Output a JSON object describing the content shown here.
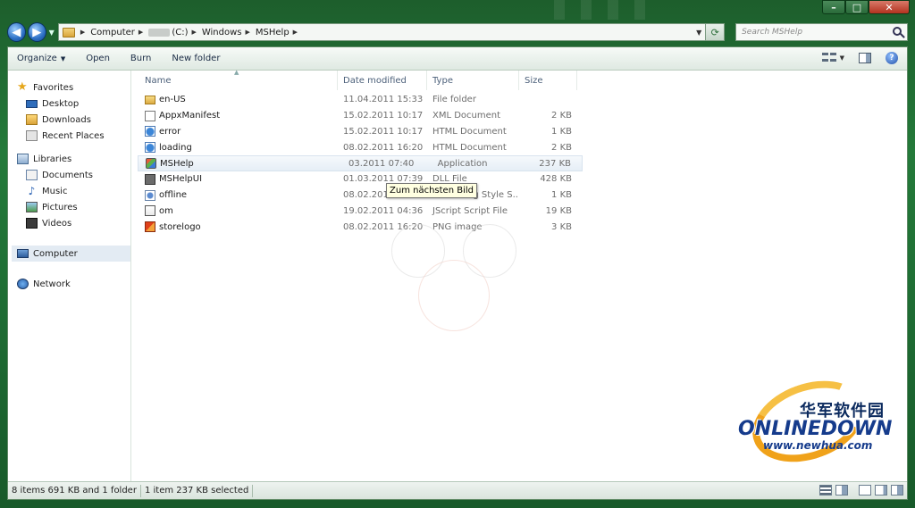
{
  "window": {
    "minimize": "–",
    "maximize": "□",
    "close": "✕"
  },
  "nav": {
    "back": "◀",
    "forward": "▶"
  },
  "address": {
    "crumbs": [
      "Computer",
      "(C:)",
      "Windows",
      "MSHelp"
    ]
  },
  "search": {
    "placeholder": "Search MSHelp"
  },
  "toolbar": {
    "organize": "Organize",
    "open": "Open",
    "burn": "Burn",
    "new_folder": "New folder"
  },
  "sidebar": {
    "favorites": "Favorites",
    "desktop": "Desktop",
    "downloads": "Downloads",
    "recent_places": "Recent Places",
    "libraries": "Libraries",
    "documents": "Documents",
    "music": "Music",
    "pictures": "Pictures",
    "videos": "Videos",
    "computer": "Computer",
    "network": "Network"
  },
  "columns": {
    "name": "Name",
    "date": "Date modified",
    "type": "Type",
    "size": "Size"
  },
  "files": [
    {
      "name": "en-US",
      "date": "11.04.2011 15:33",
      "type": "File folder",
      "size": "",
      "icon": "folder-icon"
    },
    {
      "name": "AppxManifest",
      "date": "15.02.2011 10:17",
      "type": "XML Document",
      "size": "2 KB",
      "icon": "xml-file-icon"
    },
    {
      "name": "error",
      "date": "15.02.2011 10:17",
      "type": "HTML Document",
      "size": "1 KB",
      "icon": "html-file-icon"
    },
    {
      "name": "loading",
      "date": "08.02.2011 16:20",
      "type": "HTML Document",
      "size": "2 KB",
      "icon": "html-file-icon"
    },
    {
      "name": "MSHelp",
      "date": "03.2011 07:40",
      "type": "Application",
      "size": "237 KB",
      "icon": "application-icon"
    },
    {
      "name": "MSHelpUI",
      "date": "01.03.2011 07:39",
      "type": "DLL File",
      "size": "428 KB",
      "icon": "dll-file-icon"
    },
    {
      "name": "offline",
      "date": "08.02.2011 16:20",
      "type": "Cascading Style S...",
      "size": "1 KB",
      "icon": "css-file-icon"
    },
    {
      "name": "om",
      "date": "19.02.2011 04:36",
      "type": "JScript Script File",
      "size": "19 KB",
      "icon": "js-file-icon"
    },
    {
      "name": "storelogo",
      "date": "08.02.2011 16:20",
      "type": "PNG image",
      "size": "3 KB",
      "icon": "png-file-icon"
    }
  ],
  "tooltip": "Zum nächsten Bild",
  "logo": {
    "chinese": "华军软件园",
    "main": "ONLINEDOWN",
    "url": "www.newhua.com"
  },
  "status": {
    "summary": "8 items 691 KB and 1 folder",
    "selection": "1 item 237 KB selected"
  },
  "colors": {
    "accent": "#1f6b33",
    "selection": "#e3ebf3",
    "tooltip_bg": "#ffffe1"
  }
}
